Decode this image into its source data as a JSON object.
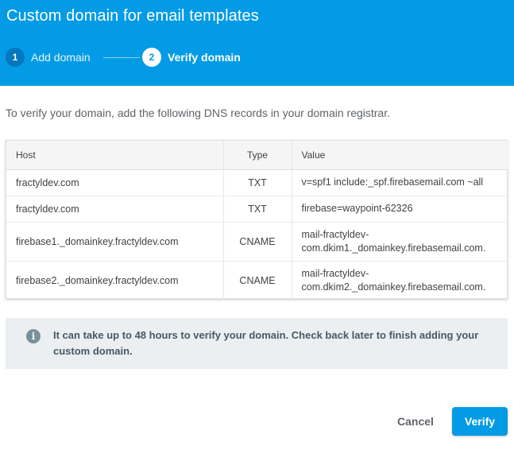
{
  "dialog": {
    "title": "Custom domain for email templates"
  },
  "stepper": {
    "steps": [
      {
        "number": "1",
        "label": "Add domain"
      },
      {
        "number": "2",
        "label": "Verify domain"
      }
    ]
  },
  "main": {
    "description": "To verify your domain, add the following DNS records in your domain registrar.",
    "table": {
      "headers": {
        "host": "Host",
        "type": "Type",
        "value": "Value"
      },
      "rows": [
        {
          "host": "fractyldev.com",
          "type": "TXT",
          "value": "v=spf1 include:_spf.firebasemail.com ~all"
        },
        {
          "host": "fractyldev.com",
          "type": "TXT",
          "value": "firebase=waypoint-62326"
        },
        {
          "host": "firebase1._domainkey.fractyldev.com",
          "type": "CNAME",
          "value": "mail-fractyldev-com.dkim1._domainkey.firebasemail.com."
        },
        {
          "host": "firebase2._domainkey.fractyldev.com",
          "type": "CNAME",
          "value": "mail-fractyldev-com.dkim2._domainkey.firebasemail.com."
        }
      ]
    },
    "info": {
      "icon": "info-icon",
      "text": "It can take up to 48 hours to verify your domain. Check back later to finish adding your custom domain."
    }
  },
  "actions": {
    "cancel_label": "Cancel",
    "verify_label": "Verify"
  },
  "colors": {
    "header_bg": "#039be5",
    "step_done": "#0277bd",
    "info_bg": "#eceff1",
    "primary_button": "#039be5"
  }
}
